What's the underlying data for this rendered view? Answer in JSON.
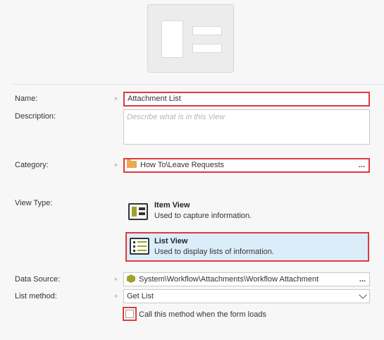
{
  "form": {
    "name_label": "Name:",
    "name_value": "Attachment List",
    "description_label": "Description:",
    "description_placeholder": "Describe what is in this View",
    "category_label": "Category:",
    "category_value": "How To\\Leave Requests",
    "category_button": "...",
    "view_type_label": "View Type:",
    "view_types": [
      {
        "title": "Item View",
        "description": "Used to capture information.",
        "selected": false
      },
      {
        "title": "List View",
        "description": "Used to display lists of information.",
        "selected": true
      }
    ],
    "data_source_label": "Data Source:",
    "data_source_value": "System\\Workflow\\Attachments\\Workflow Attachment",
    "data_source_button": "...",
    "list_method_label": "List method:",
    "list_method_value": "Get List",
    "load_checkbox_label": "Call this method when the form loads",
    "load_checkbox_checked": false,
    "required_marker": "*"
  },
  "colors": {
    "highlight_border": "#e0393e",
    "selected_bg": "#dcedfa",
    "folder": "#e8a955",
    "view_icon_accent": "#9ea22f"
  },
  "icons": {
    "thumbnail": "view-thumbnail-icon",
    "item_view": "item-view-icon",
    "list_view": "list-view-icon",
    "category": "folder-icon",
    "data_source": "smartobject-cube-icon",
    "dropdown": "chevron-down-icon"
  }
}
